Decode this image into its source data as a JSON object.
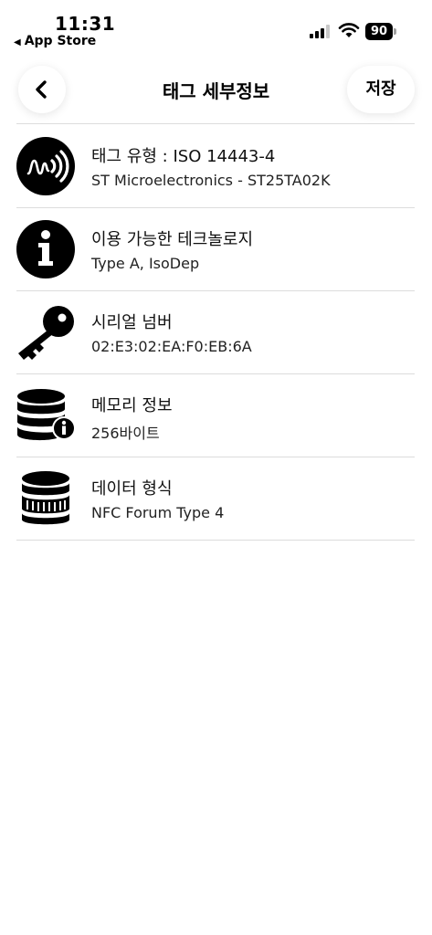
{
  "status": {
    "time": "11:31",
    "back_app": "App Store",
    "battery": "90"
  },
  "nav": {
    "title": "태그 세부정보",
    "save_label": "저장"
  },
  "items": [
    {
      "icon": "nfc-signal-icon",
      "title": "태그 유형 : ISO 14443-4",
      "subtitle": "ST Microelectronics - ST25TA02K"
    },
    {
      "icon": "info-icon",
      "title": "이용 가능한 테크놀로지",
      "subtitle": "Type A, IsoDep"
    },
    {
      "icon": "key-icon",
      "title": "시리얼 넘버",
      "subtitle": "02:E3:02:EA:F0:EB:6A"
    },
    {
      "icon": "database-info-icon",
      "title": "메모리 정보",
      "subtitle": "256바이트"
    },
    {
      "icon": "database-icon",
      "title": "데이터 형식",
      "subtitle": "NFC Forum Type 4"
    }
  ]
}
